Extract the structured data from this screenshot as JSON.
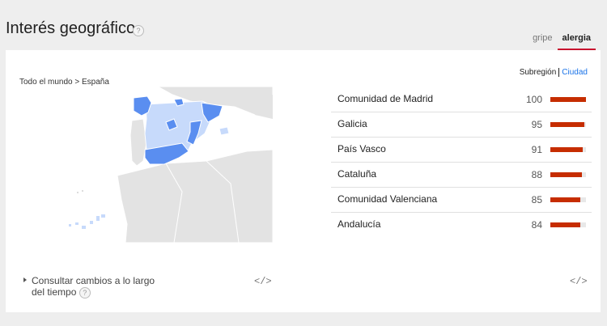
{
  "header": {
    "title": "Interés geográfico",
    "help": "?"
  },
  "tabs": [
    {
      "label": "gripe",
      "active": false
    },
    {
      "label": "alergia",
      "active": true
    }
  ],
  "breadcrumb": "Todo el mundo > España",
  "segment": {
    "subregion": "Subregión",
    "city": "Ciudad"
  },
  "regions": [
    {
      "name": "Comunidad de Madrid",
      "value": 100
    },
    {
      "name": "Galicia",
      "value": 95
    },
    {
      "name": "País Vasco",
      "value": 91
    },
    {
      "name": "Cataluña",
      "value": 88
    },
    {
      "name": "Comunidad Valenciana",
      "value": 85
    },
    {
      "name": "Andalucía",
      "value": 84
    }
  ],
  "consult": {
    "line1": "Consultar cambios a lo largo",
    "line2": "del tiempo",
    "help": "?"
  },
  "embed_glyph": "</>",
  "colors": {
    "accent_tab": "#c8102e",
    "bar": "#c62d00",
    "map_strong": "#5a8ef0",
    "map_light": "#c7dafb",
    "map_land": "#e3e3e3"
  }
}
